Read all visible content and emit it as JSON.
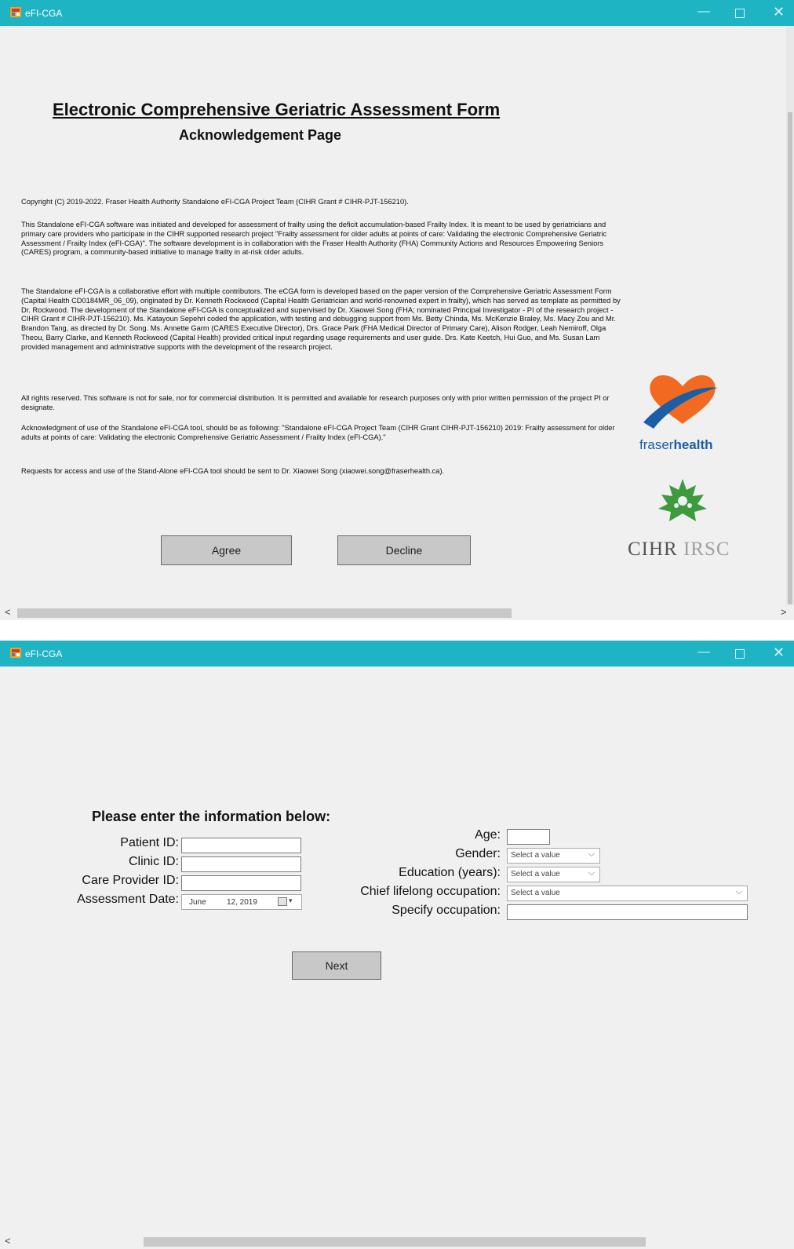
{
  "window1": {
    "title": "eFI-CGA",
    "heading": "Electronic Comprehensive Geriatric Assessment Form",
    "subheading": "Acknowledgement Page",
    "paragraphs": [
      "Copyright (C) 2019-2022. Fraser Health Authority Standalone eFI-CGA Project Team (CIHR Grant # CIHR-PJT-156210).",
      "This Standalone eFI-CGA software was initiated and developed for assessment of frailty using the deficit accumulation-based Frailty Index. It is meant to be used by geriatricians and primary care providers who participate in the CIHR supported research project \"Frailty assessment for older adults at points of care: Validating the electronic Comprehensive Geriatric Assessment / Frailty Index (eFI-CGA)\". The software development is in collaboration with the Fraser Health Authority (FHA) Community Actions and Resources Empowering Seniors (CARES) program, a community-based initiative to manage frailty in at-risk older adults.",
      "The Standalone eFI-CGA is a collaborative effort with multiple contributors. The eCGA form is developed based on the paper version of the Comprehensive Geriatric Assessment Form (Capital Health CD0184MR_06_09), originated by Dr. Kenneth Rockwood (Capital Health Geriatrician and world-renowned expert in frailty), which has served as template as permitted by Dr. Rockwood. The development of the Standalone eFI-CGA is conceptualized and supervised by Dr. Xiaowei Song (FHA; nominated Principal Investigator - PI of the research project - CIHR Grant # CIHR-PJT-156210). Ms. Katayoun Sepehri coded the application, with testing and debugging support from Ms. Betty Chinda, Ms. McKenzie Braley, Ms. Macy Zou and Mr. Brandon Tang, as directed by Dr. Song. Ms. Annette Garm (CARES Executive Director), Drs. Grace Park (FHA Medical Director of Primary Care), Alison Rodger, Leah Nemiroff, Olga Theou, Barry Clarke, and Kenneth Rockwood (Capital Health) provided critical input regarding usage requirements and user guide. Drs. Kate Keetch, Hui Guo, and Ms. Susan Lam provided management and administrative supports with the development of the research project.",
      "All rights reserved. This software is not for sale, nor for commercial distribution. It is permitted and available for research purposes only with prior written permission of the project PI or designate.",
      "Acknowledgment of use of the Standalone eFI-CGA tool, should be as following: \"Standalone eFI-CGA Project Team (CIHR Grant CIHR-PJT-156210) 2019: Frailty assessment for older adults at points of care: Validating the electronic Comprehensive Geriatric Assessment / Frailty Index (eFI-CGA).\"",
      "Requests for access and use of the Stand-Alone eFI-CGA tool should be sent to Dr. Xiaowei Song (xiaowei.song@fraserhealth.ca)."
    ],
    "agree_label": "Agree",
    "decline_label": "Decline",
    "fraser_logo": {
      "part1": "fraser",
      "part2": "health"
    },
    "cihr_logo": {
      "part1": "CIHR",
      "part2": "IRSC"
    }
  },
  "window2": {
    "title": "eFI-CGA",
    "form_title": "Please enter the information below:",
    "labels": {
      "patient_id": "Patient ID:",
      "clinic_id": "Clinic ID:",
      "care_provider_id": "Care Provider ID:",
      "assessment_date": "Assessment Date:",
      "age": "Age:",
      "gender": "Gender:",
      "education": "Education (years):",
      "occupation": "Chief lifelong occupation:",
      "specify_occupation": "Specify occupation:"
    },
    "values": {
      "patient_id": "",
      "clinic_id": "",
      "care_provider_id": "",
      "date_month": "June",
      "date_day_year": "12, 2019",
      "age": "",
      "gender": "Select a value",
      "education": "Select a value",
      "occupation": "Select a value",
      "specify_occupation": ""
    },
    "next_label": "Next"
  },
  "icons": [
    "app-icon",
    "minimize-icon",
    "maximize-icon",
    "close-icon",
    "chevron-down-icon",
    "calendar-icon",
    "scroll-left-icon",
    "scroll-right-icon"
  ],
  "colors": {
    "titlebar": "#1fb4c4",
    "fraser_orange": "#f26a21",
    "fraser_blue": "#1a5ea8",
    "cihr_green": "#3d9a3d"
  }
}
